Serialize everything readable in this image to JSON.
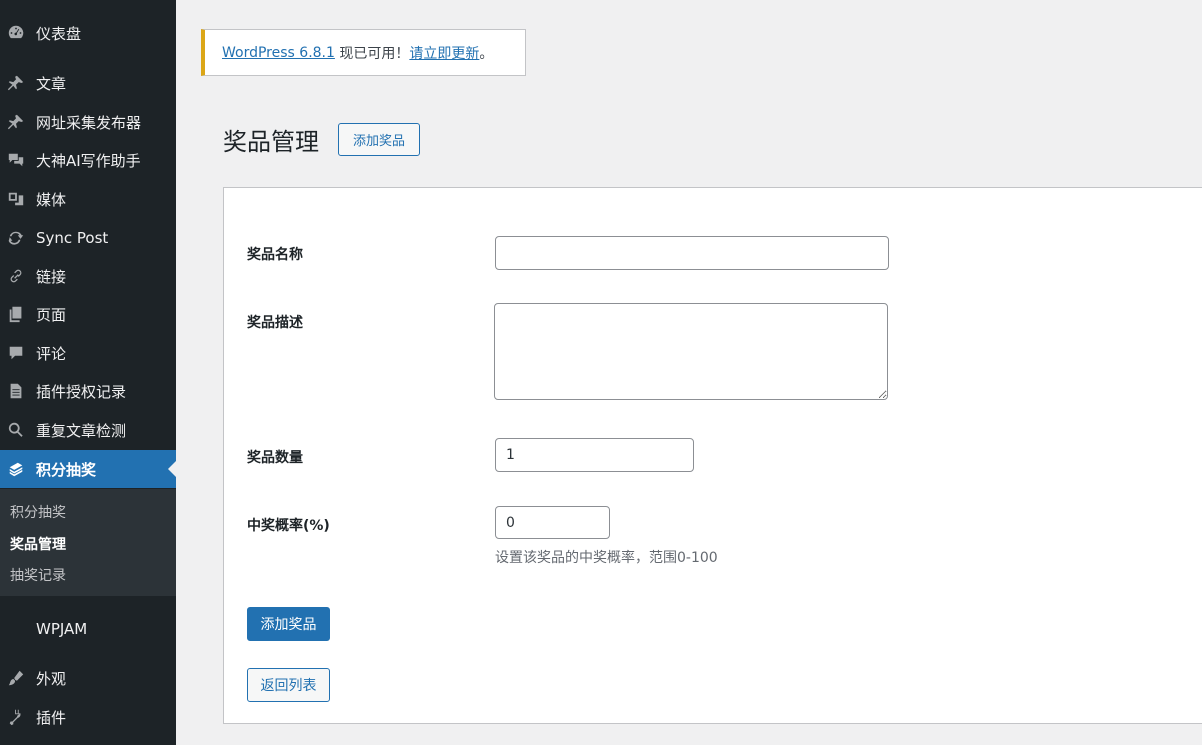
{
  "sidebar": {
    "items": [
      {
        "label": "仪表盘",
        "icon": "dashboard-icon"
      },
      {
        "label": "文章",
        "icon": "pin-icon"
      },
      {
        "label": "网址采集发布器",
        "icon": "pin-icon"
      },
      {
        "label": "大神AI写作助手",
        "icon": "comments-icon"
      },
      {
        "label": "媒体",
        "icon": "media-icon"
      },
      {
        "label": "Sync Post",
        "icon": "sync-icon"
      },
      {
        "label": "链接",
        "icon": "link-icon"
      },
      {
        "label": "页面",
        "icon": "page-icon"
      },
      {
        "label": "评论",
        "icon": "comment-icon"
      },
      {
        "label": "插件授权记录",
        "icon": "document-icon"
      },
      {
        "label": "重复文章检测",
        "icon": "search-icon"
      },
      {
        "label": "积分抽奖",
        "icon": "lottery-icon"
      },
      {
        "label": "WPJAM",
        "icon": ""
      },
      {
        "label": "外观",
        "icon": "appearance-icon"
      },
      {
        "label": "插件",
        "icon": "plugins-icon"
      }
    ],
    "submenu": [
      "积分抽奖",
      "奖品管理",
      "抽奖记录"
    ]
  },
  "notice": {
    "version_link": "WordPress 6.8.1",
    "middle_text": " 现已可用！",
    "update_link": "请立即更新",
    "end_text": "。"
  },
  "page": {
    "title": "奖品管理",
    "add_new_label": "添加奖品"
  },
  "form": {
    "name_label": "奖品名称",
    "name_value": "",
    "desc_label": "奖品描述",
    "desc_value": "",
    "quantity_label": "奖品数量",
    "quantity_value": "1",
    "probability_label": "中奖概率(%)",
    "probability_value": "0",
    "probability_hint": "设置该奖品的中奖概率，范围0-100",
    "submit_label": "添加奖品",
    "back_label": "返回列表"
  },
  "colors": {
    "sidebar_bg": "#1d2327",
    "accent": "#2271b1",
    "notice_border": "#dba617"
  }
}
